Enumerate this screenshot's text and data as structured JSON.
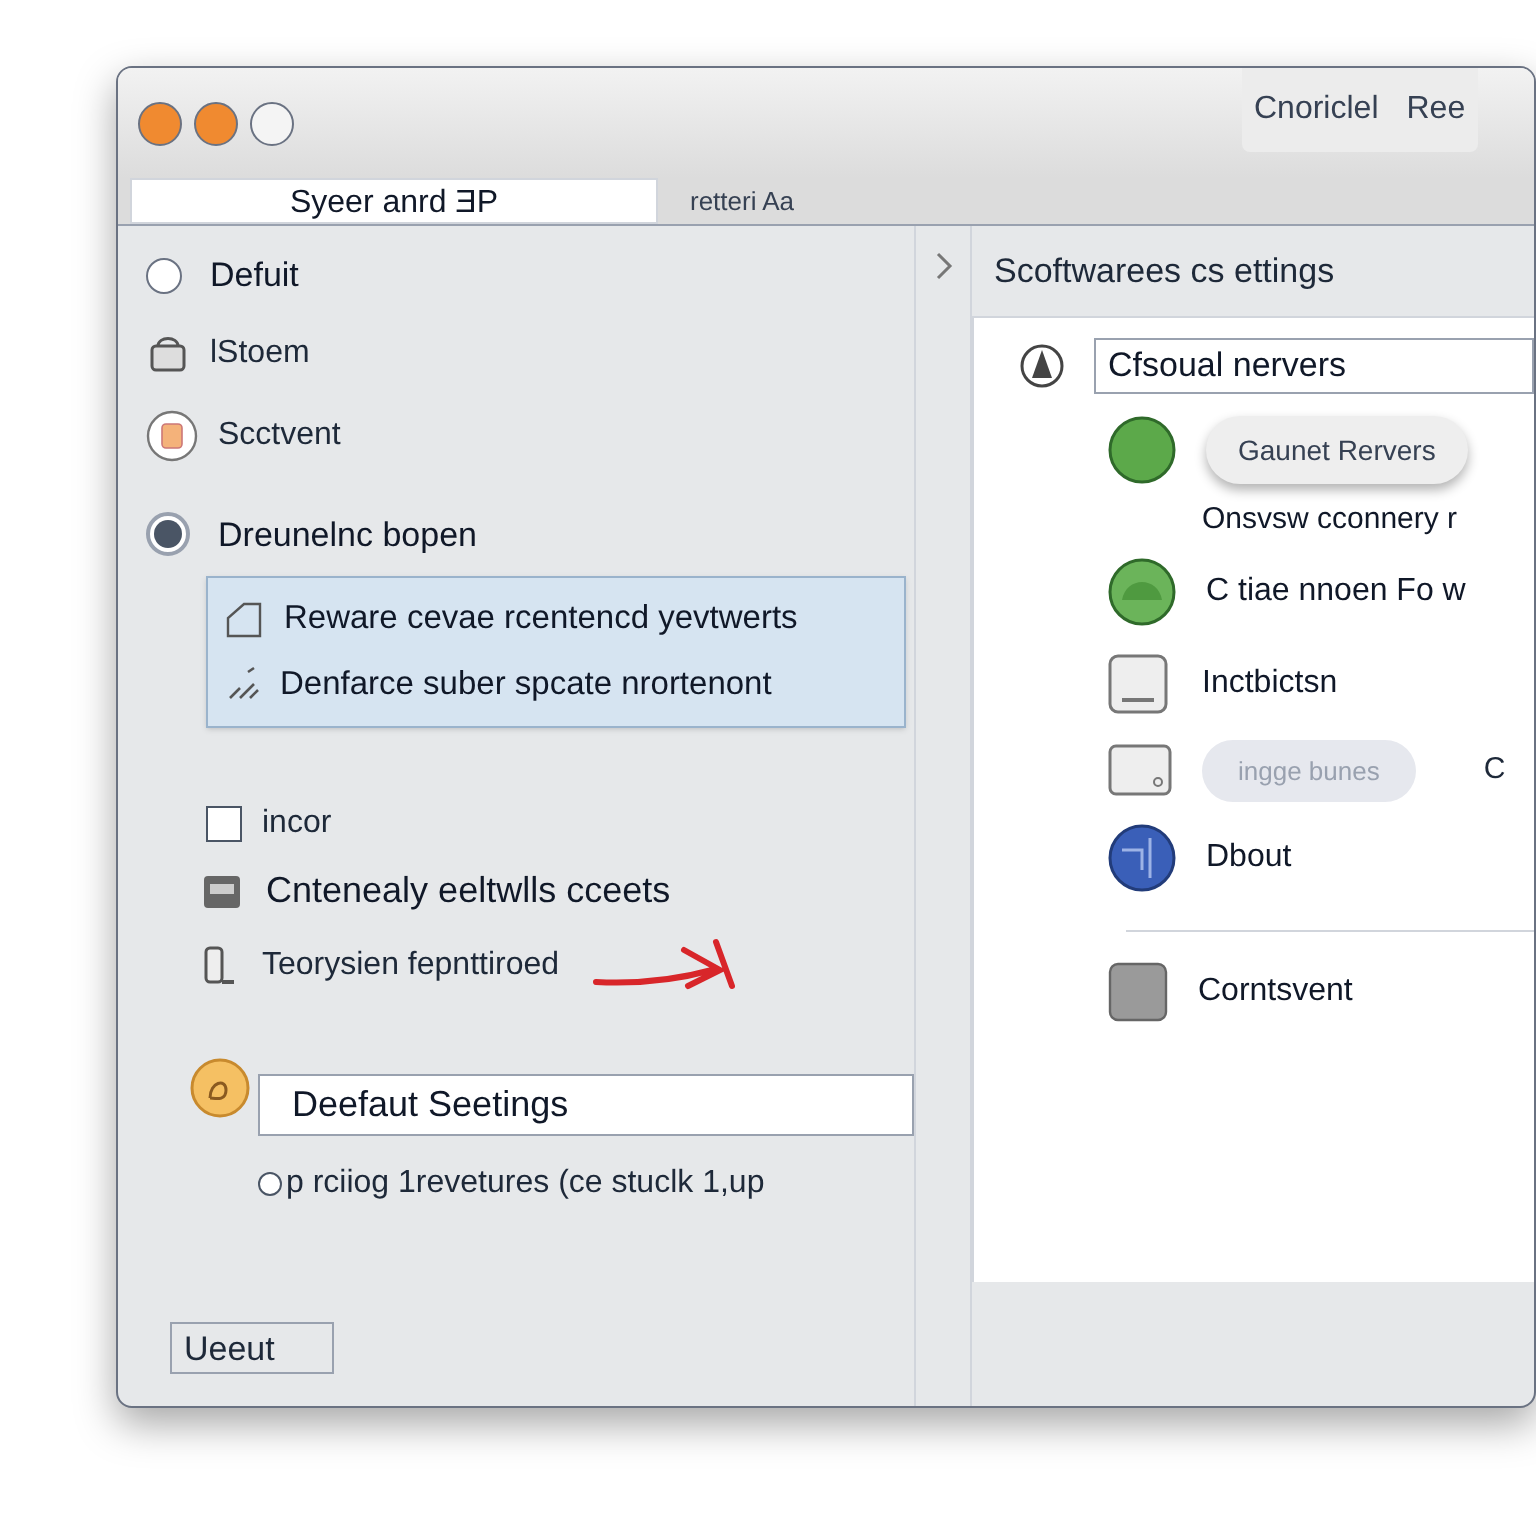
{
  "window": {
    "traffic_lights": [
      {
        "color": "#f08a30"
      },
      {
        "color": "#f08a30"
      },
      {
        "color": "#f4f4f4"
      }
    ],
    "toolbar_buttons": [
      "Cnoriclel",
      "Ree"
    ]
  },
  "tabs": [
    {
      "label": "Syeer anrd ƎP",
      "selected": true
    },
    {
      "label": "retteri Aa",
      "selected": false
    }
  ],
  "sidebar": {
    "items": [
      {
        "kind": "radio",
        "label": "Defuit",
        "selected": false
      },
      {
        "kind": "row",
        "label": "lStoem"
      },
      {
        "kind": "row",
        "label": "Scctvent"
      },
      {
        "kind": "radio",
        "label": "Dreunelnc bopen",
        "selected": true
      },
      {
        "kind": "group",
        "lines": [
          "Reware cevae rcentencd yevtwerts",
          "Denfarce suber spcate nrortenont"
        ]
      },
      {
        "kind": "checkbox",
        "label": "incor",
        "checked": false
      },
      {
        "kind": "row",
        "label": "Cntenealy eeltwlls cceets"
      },
      {
        "kind": "row",
        "label": "Teorysien fepnttiroed"
      },
      {
        "kind": "field",
        "value": "Deefaut Seetings"
      },
      {
        "kind": "radio",
        "label": "p rciiog 1revetures (ce stuclk 1,up",
        "selected": false
      }
    ],
    "bottom_button": "Ueeut"
  },
  "panel": {
    "title": "Scoftwarees cs ettings",
    "search": {
      "value": "Cfsoual nervers"
    },
    "items": [
      {
        "kind": "pill",
        "label": "Gaunet Rervers"
      },
      {
        "kind": "note",
        "label": "Onsvsw cconnery  r"
      },
      {
        "kind": "row",
        "label": "C tiae nnoen  Fo w"
      },
      {
        "kind": "row",
        "label": "Inctbictsn"
      },
      {
        "kind": "blurred",
        "label": "ingge bunes",
        "extra": "C"
      },
      {
        "kind": "row",
        "label": "Dbout"
      },
      {
        "kind": "divider"
      },
      {
        "kind": "row",
        "label": "Corntsvent"
      }
    ]
  }
}
